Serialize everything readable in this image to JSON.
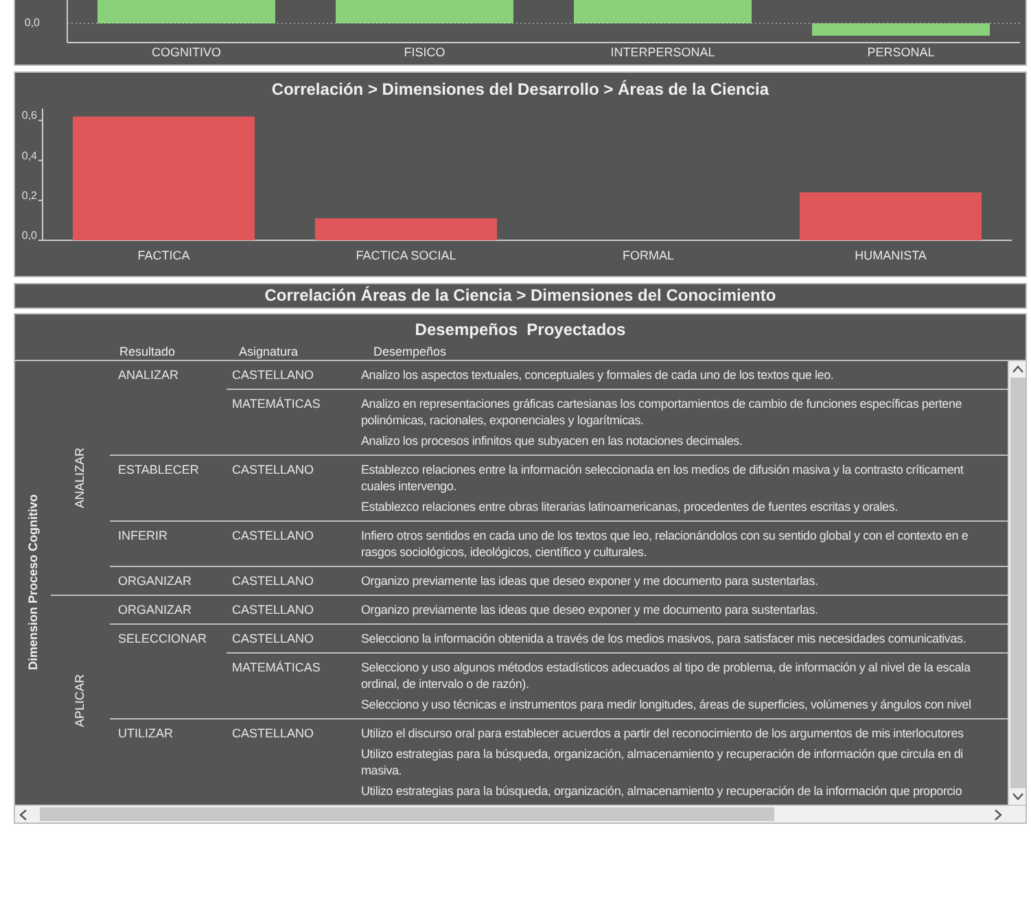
{
  "top_chart": {
    "tick": "0,0",
    "bars": [
      {
        "category": "COGNITIVO",
        "kind": "positive"
      },
      {
        "category": "FISICO",
        "kind": "positive"
      },
      {
        "category": "INTERPERSONAL",
        "kind": "positive"
      },
      {
        "category": "PERSONAL",
        "kind": "negative"
      }
    ]
  },
  "development_chart": {
    "title": "Correlación > Dimensiones del Desarrollo > Áreas de la Ciencia",
    "chart_data": {
      "type": "bar",
      "categories": [
        "FACTICA",
        "FACTICA SOCIAL",
        "FORMAL",
        "HUMANISTA"
      ],
      "values": [
        0.62,
        0.11,
        0,
        0.24
      ],
      "ylim": [
        0,
        0.66
      ],
      "yticks": [
        {
          "value": 0,
          "label": "0,0"
        },
        {
          "value": 0.2,
          "label": "0,2"
        },
        {
          "value": 0.4,
          "label": "0,4"
        },
        {
          "value": 0.6,
          "label": "0,6"
        }
      ]
    }
  },
  "knowledge_chart": {
    "title": "Correlación Áreas de la Ciencia > Dimensiones del Conocimiento"
  },
  "performances": {
    "title": "Desempeños  Proyectados",
    "columns": [
      "Resultado",
      "Asignatura",
      "Desempeños"
    ],
    "dimension": "Dimension Proceso Cognitivo",
    "groups": [
      {
        "level": "ANALIZAR",
        "results": [
          {
            "result": "ANALIZAR",
            "subjects": [
              {
                "subject": "CASTELLANO",
                "items": [
                  [
                    "Analizo los aspectos textuales, conceptuales y formales de cada uno de los textos que leo."
                  ]
                ]
              },
              {
                "subject": "MATEMÁTICAS",
                "items": [
                  [
                    "Analizo en representaciones gráficas cartesianas los comportamientos de cambio de funciones específicas pertene",
                    "polinómicas, racionales, exponenciales y logarítmicas."
                  ],
                  [
                    "Analizo los procesos infinitos que subyacen en las notaciones decimales."
                  ]
                ]
              }
            ]
          },
          {
            "result": "ESTABLECER",
            "subjects": [
              {
                "subject": "CASTELLANO",
                "items": [
                  [
                    "Establezco relaciones entre la información seleccionada en los medios de difusión masiva y la contrasto críticament",
                    "cuales intervengo."
                  ],
                  [
                    "Establezco relaciones entre obras literarias latinoamericanas, procedentes de fuentes escritas y orales."
                  ]
                ]
              }
            ]
          },
          {
            "result": "INFERIR",
            "subjects": [
              {
                "subject": "CASTELLANO",
                "items": [
                  [
                    "Infiero otros sentidos en cada uno de los textos que leo, relacionándolos con su sentido global y con el contexto en e",
                    "rasgos sociológicos, ideológicos, científico y culturales."
                  ]
                ]
              }
            ]
          },
          {
            "result": "ORGANIZAR",
            "subjects": [
              {
                "subject": "CASTELLANO",
                "items": [
                  [
                    "Organizo previamente las ideas que deseo exponer y me documento para sustentarlas."
                  ]
                ]
              }
            ]
          }
        ]
      },
      {
        "level": "APLICAR",
        "results": [
          {
            "result": "ORGANIZAR",
            "subjects": [
              {
                "subject": "CASTELLANO",
                "items": [
                  [
                    "Organizo previamente las ideas que deseo exponer y me documento para sustentarlas."
                  ]
                ]
              }
            ]
          },
          {
            "result": "SELECCIONAR",
            "subjects": [
              {
                "subject": "CASTELLANO",
                "items": [
                  [
                    "Selecciono la información obtenida a través de los medios masivos, para satisfacer mis necesidades comunicativas."
                  ]
                ]
              },
              {
                "subject": "MATEMÁTICAS",
                "items": [
                  [
                    "Selecciono y uso algunos métodos estadísticos adecuados al tipo de problema, de información y al nivel de la escala",
                    "ordinal, de intervalo o de razón)."
                  ],
                  [
                    "Selecciono y uso técnicas e instrumentos para medir longitudes, áreas de superficies, volúmenes y ángulos con nivel"
                  ]
                ]
              }
            ]
          },
          {
            "result": "UTILIZAR",
            "subjects": [
              {
                "subject": "CASTELLANO",
                "items": [
                  [
                    "Utilizo el discurso oral para establecer acuerdos a partir del reconocimiento de los argumentos de mis interlocutores"
                  ],
                  [
                    "Utilizo estrategias para la búsqueda, organización, almacenamiento y recuperación de información que circula en di",
                    "masiva."
                  ],
                  [
                    "Utilizo estrategias para la búsqueda, organización, almacenamiento y recuperación de la información que proporcio"
                  ]
                ]
              }
            ]
          }
        ]
      }
    ]
  }
}
